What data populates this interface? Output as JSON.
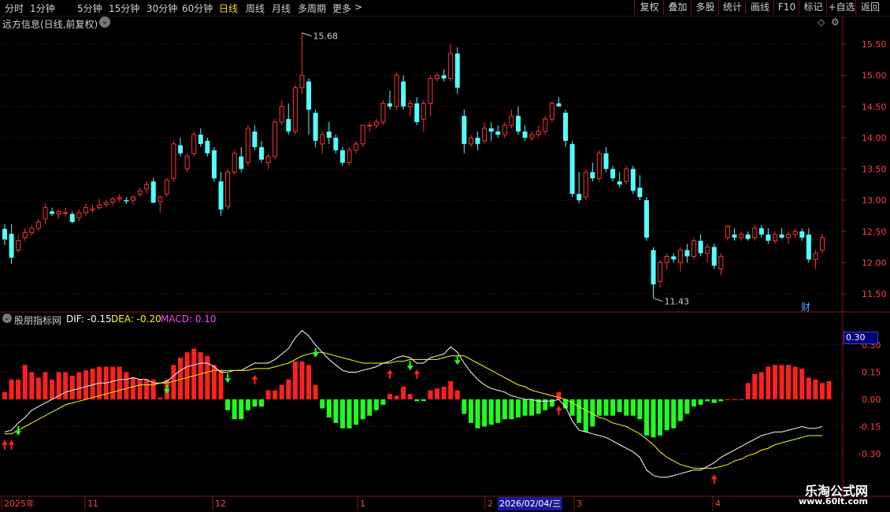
{
  "toolbar": {
    "periods": [
      "分时",
      "1分钟",
      "5分钟",
      "15分钟",
      "30分钟",
      "60分钟",
      "日线",
      "周线",
      "月线",
      "多周期",
      "更多"
    ],
    "active_period": "日线",
    "more_arrow": ">",
    "buttons": [
      "复权",
      "叠加",
      "多股",
      "统计",
      "画线",
      "F10",
      "标记",
      "+自选",
      "返回"
    ]
  },
  "main_panel": {
    "title": "远方信息(日线,前复权)",
    "price_axis": [
      "15.50",
      "15.00",
      "14.50",
      "14.00",
      "13.50",
      "13.00",
      "12.50",
      "12.00",
      "11.50"
    ],
    "high_label": "15.68",
    "low_label": "11.43",
    "fin_badge": "财",
    "colors": {
      "up": "#ff3232",
      "down": "#54ffff"
    }
  },
  "indicator_panel": {
    "name": "股朋指标网",
    "dif_label": "DIF: -0.15",
    "dea_label": "DEA: -0.20",
    "macd_label": "MACD: 0.10",
    "axis": [
      "0.30",
      "0.15",
      "0.00",
      "-0.15",
      "-0.30"
    ],
    "current_value": "0.30",
    "colors": {
      "dif": "#ffffff",
      "dea": "#ffff00",
      "macd": "#ff40ff",
      "pos": "#ff2020",
      "neg": "#20ff20"
    }
  },
  "date_axis": {
    "labels": [
      "2025年",
      "11",
      "12",
      "1",
      "2",
      "3",
      "4"
    ],
    "cursor_date": "2026/02/04/三"
  },
  "watermark": {
    "name": "乐淘公式网",
    "url": "www.60lt.com"
  },
  "chart_data": [
    {
      "type": "candlestick",
      "title": "远方信息(日线,前复权)",
      "ylim": [
        11.3,
        15.8
      ],
      "high_marker": 15.68,
      "low_marker": 11.43,
      "ohlc": [
        [
          12.54,
          12.62,
          12.28,
          12.37
        ],
        [
          12.46,
          12.62,
          11.98,
          12.08
        ],
        [
          12.2,
          12.45,
          12.16,
          12.35
        ],
        [
          12.4,
          12.55,
          12.35,
          12.48
        ],
        [
          12.48,
          12.6,
          12.43,
          12.55
        ],
        [
          12.55,
          12.7,
          12.5,
          12.65
        ],
        [
          12.7,
          12.95,
          12.62,
          12.88
        ],
        [
          12.82,
          12.88,
          12.75,
          12.78
        ],
        [
          12.78,
          12.85,
          12.7,
          12.82
        ],
        [
          12.8,
          12.88,
          12.74,
          12.8
        ],
        [
          12.78,
          12.82,
          12.63,
          12.65
        ],
        [
          12.72,
          12.85,
          12.66,
          12.8
        ],
        [
          12.8,
          12.95,
          12.75,
          12.88
        ],
        [
          12.84,
          12.92,
          12.8,
          12.86
        ],
        [
          12.88,
          13.02,
          12.85,
          12.92
        ],
        [
          12.93,
          13.0,
          12.88,
          12.96
        ],
        [
          12.97,
          13.05,
          12.91,
          13.02
        ],
        [
          13.02,
          13.1,
          12.96,
          13.04
        ],
        [
          13.0,
          13.05,
          12.94,
          12.98
        ],
        [
          13.0,
          13.08,
          12.93,
          13.05
        ],
        [
          13.1,
          13.2,
          13.05,
          13.15
        ],
        [
          13.18,
          13.3,
          13.1,
          13.25
        ],
        [
          13.3,
          13.36,
          12.95,
          12.96
        ],
        [
          12.98,
          13.08,
          12.8,
          13.05
        ],
        [
          13.1,
          13.35,
          13.05,
          13.32
        ],
        [
          13.35,
          13.95,
          13.3,
          13.9
        ],
        [
          13.88,
          14.0,
          13.7,
          13.75
        ],
        [
          13.5,
          13.75,
          13.45,
          13.7
        ],
        [
          13.75,
          14.1,
          13.7,
          14.05
        ],
        [
          14.05,
          14.15,
          13.85,
          13.9
        ],
        [
          13.95,
          14.0,
          13.7,
          13.75
        ],
        [
          13.8,
          13.85,
          13.3,
          13.35
        ],
        [
          13.3,
          13.45,
          12.75,
          12.85
        ],
        [
          12.9,
          13.5,
          12.85,
          13.45
        ],
        [
          13.45,
          13.8,
          13.4,
          13.75
        ],
        [
          13.7,
          13.85,
          13.45,
          13.5
        ],
        [
          13.6,
          14.2,
          13.55,
          14.15
        ],
        [
          14.1,
          14.2,
          13.8,
          13.85
        ],
        [
          13.85,
          13.95,
          13.6,
          13.65
        ],
        [
          13.6,
          13.75,
          13.5,
          13.7
        ],
        [
          13.7,
          14.3,
          13.65,
          14.25
        ],
        [
          14.25,
          14.6,
          14.2,
          14.5
        ],
        [
          14.3,
          14.55,
          14.05,
          14.1
        ],
        [
          14.1,
          14.85,
          14.05,
          14.8
        ],
        [
          14.8,
          15.68,
          14.7,
          15.0
        ],
        [
          14.9,
          14.95,
          14.05,
          14.45
        ],
        [
          14.4,
          14.45,
          13.85,
          13.95
        ],
        [
          13.9,
          14.1,
          13.75,
          14.05
        ],
        [
          14.1,
          14.25,
          13.9,
          14.0
        ],
        [
          14.0,
          14.05,
          13.75,
          13.8
        ],
        [
          13.8,
          13.85,
          13.55,
          13.6
        ],
        [
          13.6,
          13.85,
          13.55,
          13.8
        ],
        [
          13.8,
          13.95,
          13.75,
          13.9
        ],
        [
          13.9,
          14.2,
          13.85,
          14.2
        ],
        [
          14.2,
          14.25,
          14.1,
          14.2
        ],
        [
          14.2,
          14.3,
          14.15,
          14.25
        ],
        [
          14.25,
          14.6,
          14.2,
          14.55
        ],
        [
          14.55,
          14.75,
          14.45,
          14.5
        ],
        [
          14.5,
          15.05,
          14.45,
          15.0
        ],
        [
          14.9,
          15.0,
          14.45,
          14.5
        ],
        [
          14.5,
          14.6,
          14.35,
          14.55
        ],
        [
          14.55,
          14.65,
          14.2,
          14.25
        ],
        [
          14.3,
          14.6,
          14.1,
          14.55
        ],
        [
          14.55,
          15.0,
          14.35,
          14.95
        ],
        [
          14.95,
          15.05,
          14.9,
          15.0
        ],
        [
          15.0,
          15.1,
          14.9,
          14.95
        ],
        [
          14.95,
          15.5,
          14.9,
          15.35
        ],
        [
          15.35,
          15.45,
          14.7,
          14.8
        ],
        [
          14.35,
          14.45,
          13.75,
          13.9
        ],
        [
          13.9,
          14.05,
          13.85,
          14.0
        ],
        [
          14.0,
          14.1,
          13.8,
          13.9
        ],
        [
          13.95,
          14.25,
          13.9,
          14.15
        ],
        [
          14.15,
          14.25,
          13.95,
          14.1
        ],
        [
          14.1,
          14.2,
          14.0,
          14.05
        ],
        [
          14.05,
          14.25,
          14.0,
          14.2
        ],
        [
          14.2,
          14.45,
          14.15,
          14.35
        ],
        [
          14.35,
          14.5,
          14.05,
          14.1
        ],
        [
          14.1,
          14.2,
          13.95,
          14.0
        ],
        [
          14.0,
          14.1,
          13.95,
          14.05
        ],
        [
          14.05,
          14.2,
          14.0,
          14.1
        ],
        [
          14.1,
          14.35,
          14.05,
          14.3
        ],
        [
          14.3,
          14.6,
          14.25,
          14.55
        ],
        [
          14.55,
          14.65,
          14.5,
          14.5
        ],
        [
          14.4,
          14.45,
          13.85,
          13.95
        ],
        [
          13.9,
          13.95,
          13.05,
          13.1
        ],
        [
          13.1,
          13.45,
          12.95,
          13.0
        ],
        [
          13.05,
          13.5,
          13.0,
          13.45
        ],
        [
          13.45,
          13.6,
          13.3,
          13.35
        ],
        [
          13.35,
          13.8,
          13.3,
          13.75
        ],
        [
          13.75,
          13.85,
          13.45,
          13.5
        ],
        [
          13.5,
          13.55,
          13.3,
          13.35
        ],
        [
          13.3,
          13.45,
          13.2,
          13.25
        ],
        [
          13.3,
          13.55,
          13.25,
          13.5
        ],
        [
          13.5,
          13.55,
          13.1,
          13.15
        ],
        [
          13.2,
          13.4,
          13.0,
          13.05
        ],
        [
          13.0,
          13.05,
          12.35,
          12.4
        ],
        [
          12.2,
          12.25,
          11.43,
          11.65
        ],
        [
          11.7,
          12.05,
          11.6,
          12.0
        ],
        [
          12.0,
          12.15,
          11.9,
          12.1
        ],
        [
          12.1,
          12.15,
          12.0,
          12.05
        ],
        [
          12.0,
          12.25,
          11.85,
          12.2
        ],
        [
          12.2,
          12.3,
          12.0,
          12.1
        ],
        [
          12.1,
          12.4,
          12.05,
          12.35
        ],
        [
          12.35,
          12.45,
          12.1,
          12.15
        ],
        [
          12.15,
          12.3,
          12.0,
          12.25
        ],
        [
          12.25,
          12.3,
          11.9,
          11.95
        ],
        [
          11.9,
          12.15,
          11.8,
          12.1
        ],
        [
          12.4,
          12.6,
          12.35,
          12.58
        ],
        [
          12.45,
          12.55,
          12.35,
          12.4
        ],
        [
          12.4,
          12.5,
          12.35,
          12.45
        ],
        [
          12.45,
          12.5,
          12.35,
          12.38
        ],
        [
          12.4,
          12.6,
          12.35,
          12.55
        ],
        [
          12.55,
          12.6,
          12.4,
          12.45
        ],
        [
          12.45,
          12.55,
          12.3,
          12.35
        ],
        [
          12.35,
          12.5,
          12.3,
          12.45
        ],
        [
          12.45,
          12.55,
          12.38,
          12.4
        ],
        [
          12.4,
          12.5,
          12.3,
          12.45
        ],
        [
          12.45,
          12.55,
          12.4,
          12.5
        ],
        [
          12.5,
          12.55,
          12.35,
          12.4
        ],
        [
          12.45,
          12.55,
          12.0,
          12.05
        ],
        [
          12.05,
          12.2,
          11.9,
          12.15
        ],
        [
          12.2,
          12.45,
          12.15,
          12.4
        ]
      ]
    },
    {
      "type": "bar+line",
      "title": "股朋指标网",
      "ylim": [
        -0.42,
        0.38
      ],
      "series_names": [
        "DIF",
        "DEA",
        "MACD"
      ],
      "macd": [
        0.04,
        0.11,
        0.11,
        0.19,
        0.15,
        0.12,
        0.15,
        0.11,
        0.15,
        0.15,
        0.13,
        0.15,
        0.16,
        0.17,
        0.18,
        0.18,
        0.18,
        0.18,
        0.15,
        0.12,
        0.11,
        0.11,
        0.11,
        0.01,
        0.11,
        0.19,
        0.23,
        0.26,
        0.28,
        0.26,
        0.24,
        0.19,
        0.16,
        -0.06,
        -0.11,
        -0.11,
        -0.06,
        -0.04,
        -0.04,
        0.05,
        0.05,
        0.08,
        0.11,
        0.21,
        0.21,
        0.19,
        0.08,
        -0.05,
        -0.1,
        -0.13,
        -0.16,
        -0.16,
        -0.14,
        -0.11,
        -0.09,
        -0.06,
        -0.03,
        0.03,
        0.02,
        0.07,
        0.03,
        -0.01,
        -0.01,
        0.05,
        0.06,
        0.07,
        0.1,
        0.05,
        -0.08,
        -0.13,
        -0.16,
        -0.15,
        -0.14,
        -0.13,
        -0.11,
        -0.11,
        -0.1,
        -0.09,
        -0.09,
        -0.08,
        -0.06,
        -0.04,
        0.04,
        -0.05,
        -0.09,
        -0.13,
        -0.18,
        -0.15,
        -0.09,
        -0.09,
        -0.09,
        -0.07,
        -0.09,
        -0.09,
        -0.11,
        -0.2,
        -0.21,
        -0.2,
        -0.17,
        -0.16,
        -0.12,
        -0.08,
        -0.04,
        -0.03,
        -0.01,
        -0.02,
        -0.01,
        0.0,
        0.0,
        0.0,
        0.09,
        0.14,
        0.15,
        0.18,
        0.19,
        0.19,
        0.19,
        0.18,
        0.17,
        0.12,
        0.11,
        0.09,
        0.1
      ],
      "dif": [
        -0.18,
        -0.17,
        -0.13,
        -0.1,
        -0.06,
        -0.04,
        -0.02,
        0.0,
        0.02,
        0.04,
        0.05,
        0.06,
        0.07,
        0.08,
        0.09,
        0.09,
        0.1,
        0.11,
        0.11,
        0.12,
        0.11,
        0.11,
        0.09,
        0.09,
        0.1,
        0.13,
        0.16,
        0.18,
        0.19,
        0.2,
        0.2,
        0.18,
        0.15,
        0.15,
        0.16,
        0.16,
        0.18,
        0.2,
        0.2,
        0.2,
        0.22,
        0.25,
        0.28,
        0.34,
        0.38,
        0.35,
        0.3,
        0.26,
        0.22,
        0.19,
        0.16,
        0.15,
        0.15,
        0.16,
        0.17,
        0.18,
        0.2,
        0.21,
        0.23,
        0.24,
        0.23,
        0.2,
        0.2,
        0.23,
        0.24,
        0.25,
        0.29,
        0.26,
        0.2,
        0.15,
        0.11,
        0.08,
        0.06,
        0.05,
        0.04,
        0.02,
        0.01,
        0.0,
        0.0,
        -0.01,
        -0.01,
        -0.01,
        0.0,
        -0.04,
        -0.12,
        -0.17,
        -0.18,
        -0.19,
        -0.2,
        -0.21,
        -0.23,
        -0.25,
        -0.27,
        -0.29,
        -0.32,
        -0.39,
        -0.42,
        -0.43,
        -0.43,
        -0.42,
        -0.41,
        -0.4,
        -0.39,
        -0.39,
        -0.37,
        -0.35,
        -0.32,
        -0.3,
        -0.28,
        -0.26,
        -0.24,
        -0.22,
        -0.2,
        -0.19,
        -0.18,
        -0.18,
        -0.17,
        -0.16,
        -0.15,
        -0.16,
        -0.16,
        -0.15
      ],
      "dea": [
        -0.19,
        -0.19,
        -0.17,
        -0.15,
        -0.13,
        -0.11,
        -0.09,
        -0.07,
        -0.05,
        -0.03,
        -0.02,
        -0.01,
        0.0,
        0.01,
        0.02,
        0.03,
        0.04,
        0.05,
        0.06,
        0.07,
        0.08,
        0.08,
        0.08,
        0.09,
        0.09,
        0.1,
        0.11,
        0.12,
        0.13,
        0.14,
        0.15,
        0.16,
        0.16,
        0.16,
        0.16,
        0.16,
        0.16,
        0.17,
        0.17,
        0.17,
        0.18,
        0.19,
        0.2,
        0.22,
        0.24,
        0.25,
        0.26,
        0.26,
        0.25,
        0.24,
        0.23,
        0.22,
        0.21,
        0.2,
        0.2,
        0.2,
        0.2,
        0.2,
        0.21,
        0.21,
        0.22,
        0.22,
        0.22,
        0.22,
        0.22,
        0.23,
        0.24,
        0.24,
        0.24,
        0.22,
        0.2,
        0.18,
        0.16,
        0.14,
        0.12,
        0.1,
        0.08,
        0.07,
        0.05,
        0.04,
        0.03,
        0.02,
        0.01,
        0.0,
        -0.02,
        -0.04,
        -0.06,
        -0.08,
        -0.1,
        -0.11,
        -0.13,
        -0.14,
        -0.15,
        -0.17,
        -0.19,
        -0.22,
        -0.25,
        -0.29,
        -0.32,
        -0.34,
        -0.36,
        -0.37,
        -0.38,
        -0.38,
        -0.38,
        -0.38,
        -0.37,
        -0.36,
        -0.34,
        -0.33,
        -0.31,
        -0.3,
        -0.28,
        -0.27,
        -0.25,
        -0.24,
        -0.23,
        -0.22,
        -0.21,
        -0.2,
        -0.2,
        -0.2
      ],
      "up_arrows": [
        0,
        1,
        37,
        57,
        61,
        82,
        105
      ],
      "down_arrows": [
        2,
        24,
        33,
        46,
        60,
        67
      ]
    }
  ]
}
